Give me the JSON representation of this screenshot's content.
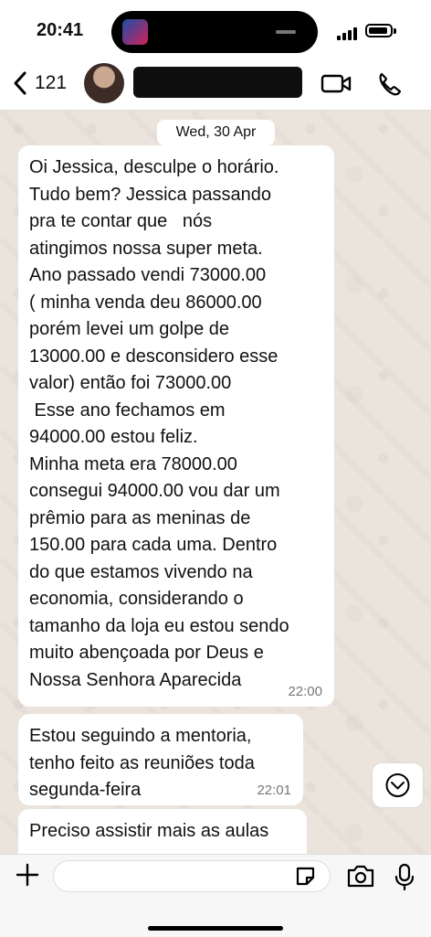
{
  "status": {
    "time": "20:41"
  },
  "header": {
    "back_count": "121"
  },
  "chat": {
    "date": "Wed, 30 Apr",
    "messages": [
      {
        "text": "Oi Jessica, desculpe o horário.\nTudo bem? Jessica passando\npra te contar que   nós\natingimos nossa super meta.\nAno passado vendi 73000.00\n( minha venda deu 86000.00\nporém levei um golpe de\n13000.00 e desconsidero esse\nvalor) então foi 73000.00\n Esse ano fechamos em\n94000.00 estou feliz.\nMinha meta era 78000.00\nconsegui 94000.00 vou dar um\nprêmio para as meninas de\n150.00 para cada uma. Dentro\ndo que estamos vivendo na\neconomia, considerando o\ntamanho da loja eu estou sendo\nmuito abençoada por Deus e\nNossa Senhora Aparecida",
        "time": "22:00"
      },
      {
        "text": "Estou seguindo a mentoria,\ntenho feito as reuniões toda\nsegunda-feira",
        "time": "22:01"
      },
      {
        "text": "Preciso assistir mais as aulas",
        "time": ""
      }
    ]
  },
  "icons": {
    "back": "chevron-left-icon",
    "video": "video-camera-icon",
    "call": "phone-icon",
    "scroll": "chevron-down-circle-icon",
    "add": "plus-icon",
    "sticker": "sticker-icon",
    "camera": "camera-icon",
    "mic": "microphone-icon"
  }
}
